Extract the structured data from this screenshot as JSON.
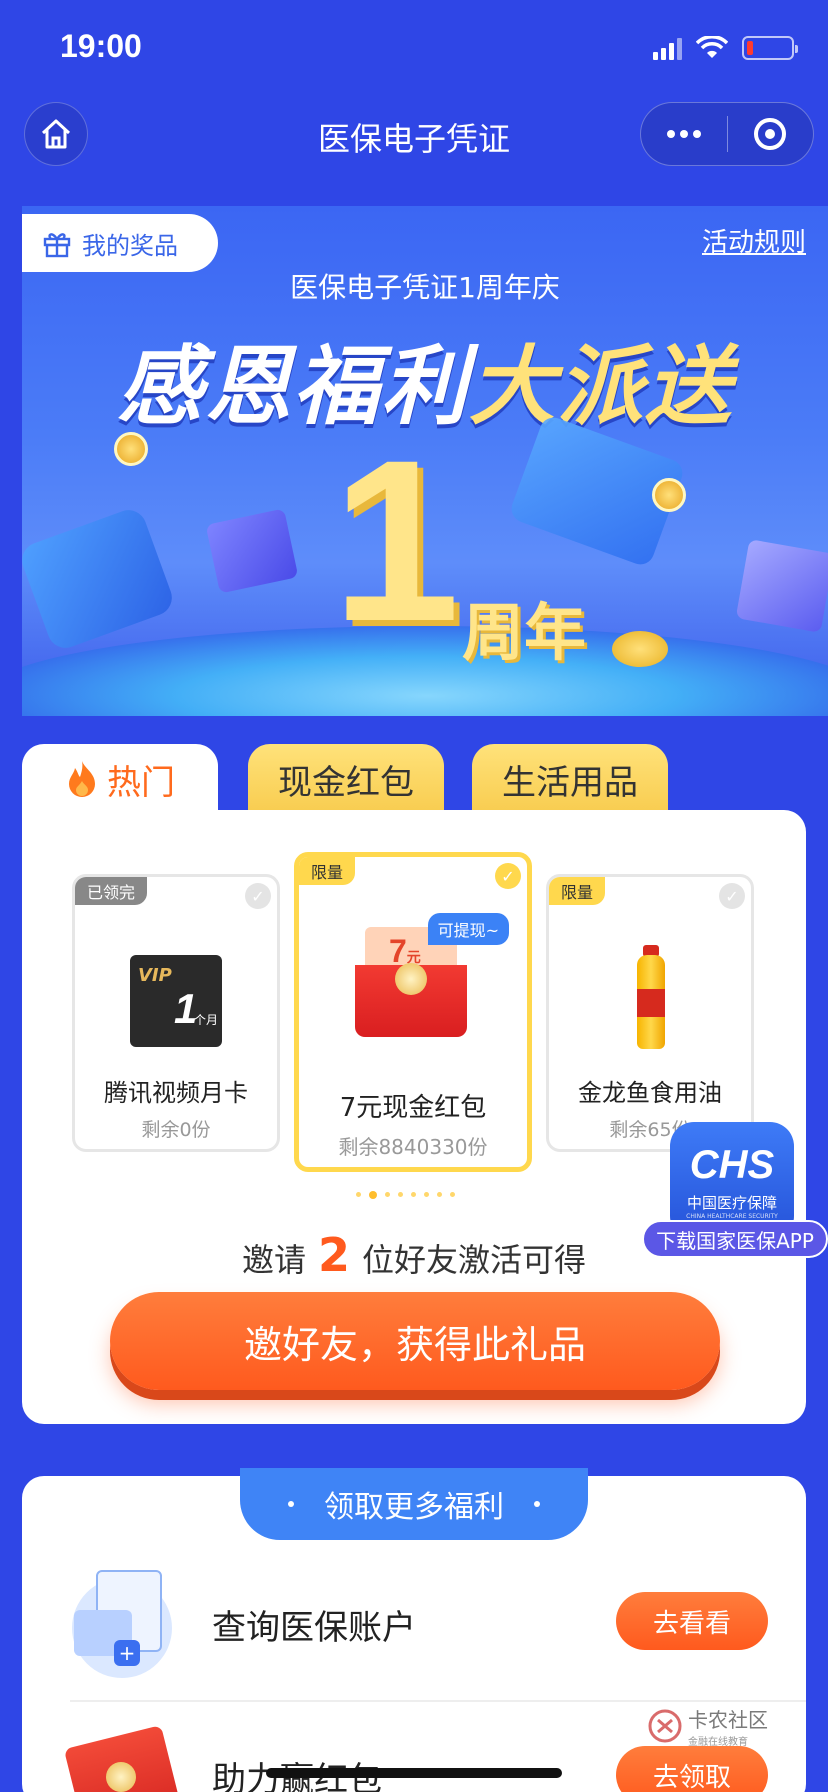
{
  "status_bar": {
    "time": "19:00"
  },
  "nav": {
    "title": "医保电子凭证"
  },
  "banner": {
    "my_prizes": "我的奖品",
    "rules": "活动规则",
    "subtitle": "医保电子凭证1周年庆",
    "headline_white": "感恩福利",
    "headline_yellow": "大派送",
    "big_number": "1",
    "anniversary": "周年"
  },
  "tabs": [
    {
      "label": "热门",
      "active": true
    },
    {
      "label": "现金红包",
      "active": false
    },
    {
      "label": "生活用品",
      "active": false
    }
  ],
  "gifts": [
    {
      "badge": "已领完",
      "name": "腾讯视频月卡",
      "remaining": "剩余0份",
      "icon": "tencent-video-vip-card-icon",
      "vip_text": "VIP",
      "month_num": "1",
      "month_unit": "个月"
    },
    {
      "badge": "限量",
      "name": "7元现金红包",
      "remaining": "剩余8840330份",
      "icon": "red-envelope-icon",
      "tag": "可提现~",
      "amount": "7",
      "amount_unit": "元"
    },
    {
      "badge": "限量",
      "name": "金龙鱼食用油",
      "remaining": "剩余65份",
      "icon": "cooking-oil-bottle-icon"
    }
  ],
  "carousel": {
    "page_count": 8,
    "active_index": 1
  },
  "invite": {
    "prefix": "邀请",
    "count": "2",
    "suffix": "位好友激活可得",
    "button": "邀好友，获得此礼品"
  },
  "chs_float": {
    "logo": "CHS",
    "name": "中国医疗保障",
    "english": "CHINA HEALTHCARE SECURITY",
    "label": "下载国家医保APP"
  },
  "more_benefits": {
    "title": "领取更多福利",
    "items": [
      {
        "title": "查询医保账户",
        "button": "去看看",
        "icon": "medical-insurance-account-icon"
      },
      {
        "title": "助力赢红包",
        "button": "去领取",
        "icon": "red-envelope-icon"
      }
    ]
  },
  "watermark": {
    "main": "卡农社区",
    "sub": "金融在线教育"
  },
  "colors": {
    "background": "#2f46e6",
    "accent_orange": "#ff5a1e",
    "tab_yellow": "#ffe27a",
    "highlight_yellow": "#ffd84d",
    "button_blue": "#3f84f6"
  }
}
